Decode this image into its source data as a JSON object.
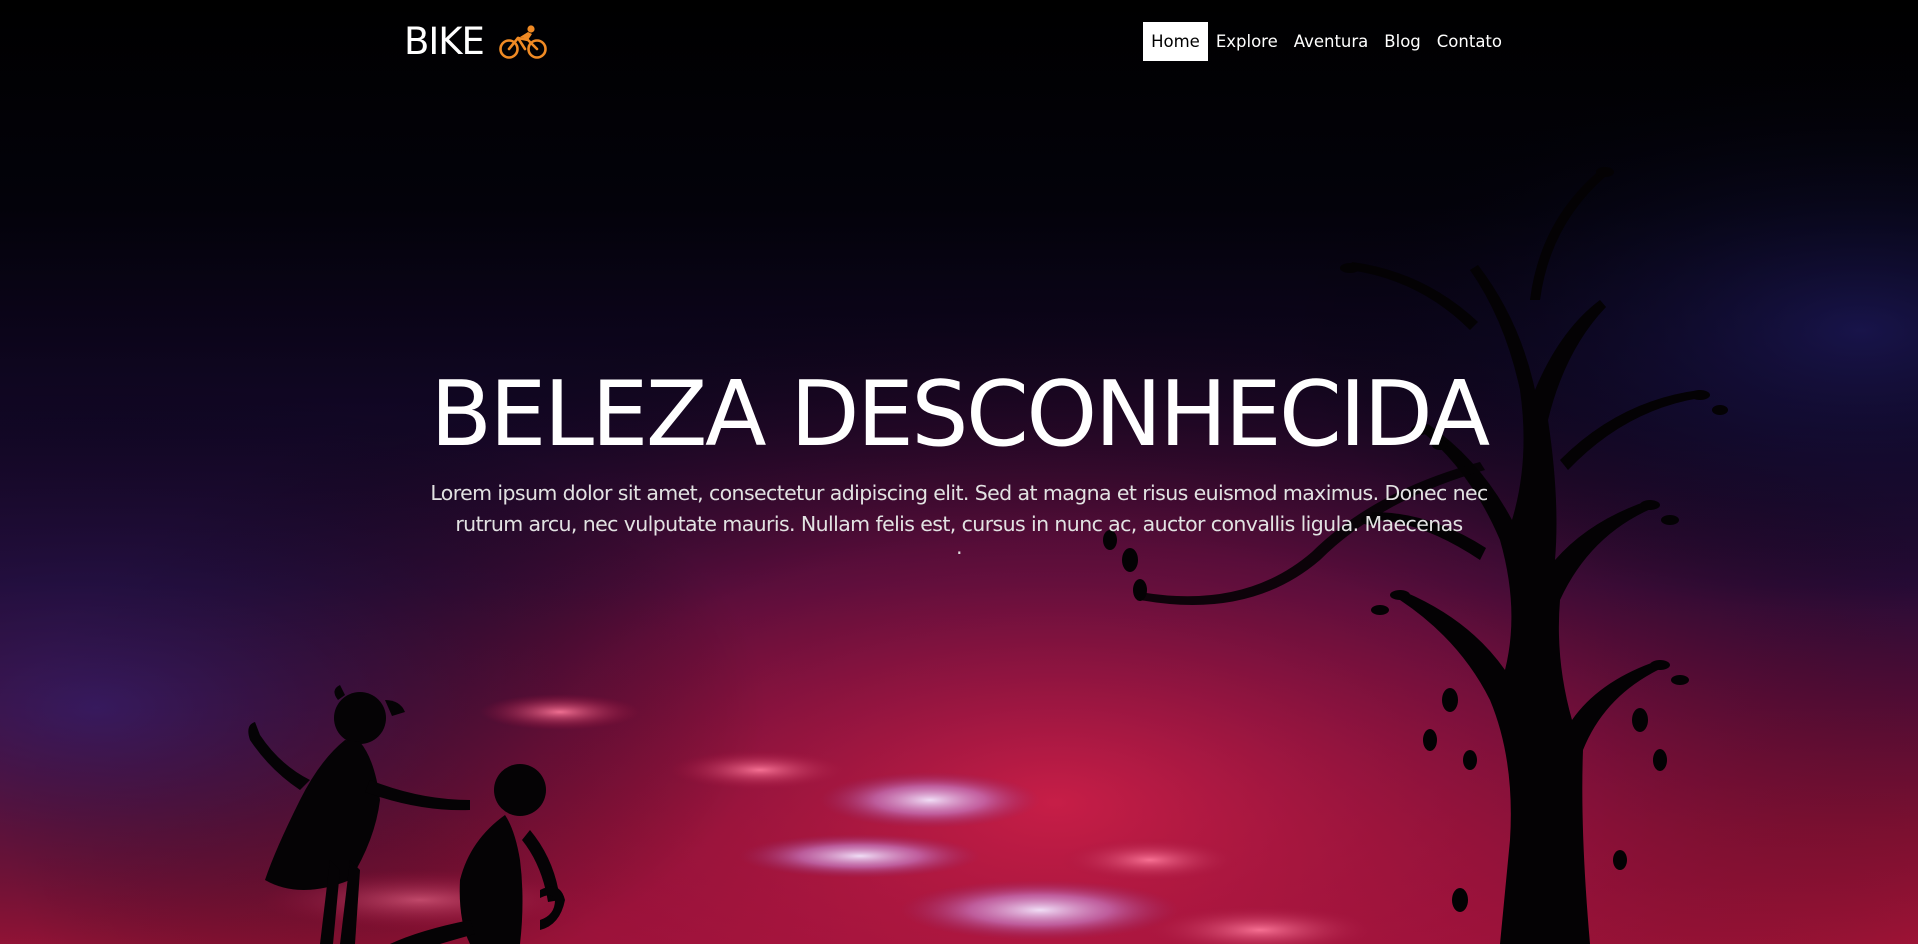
{
  "brand": {
    "name": "BIKE",
    "icon": "cyclist-icon",
    "icon_color": "#f08a24"
  },
  "nav": {
    "items": [
      {
        "label": "Home",
        "active": true
      },
      {
        "label": "Explore",
        "active": false
      },
      {
        "label": "Aventura",
        "active": false
      },
      {
        "label": "Blog",
        "active": false
      },
      {
        "label": "Contato",
        "active": false
      }
    ]
  },
  "hero": {
    "title": "BELEZA DESCONHECIDA",
    "text": "Lorem ipsum dolor sit amet, consectetur adipiscing elit. Sed at magna et risus euismod maximus. Donec nec rutrum arcu, nec vulputate mauris. Nullam felis est, cursus in nunc ac, auctor convallis ligula. Maecenas",
    "trailing": "."
  },
  "colors": {
    "sky_top": "#000000",
    "sky_purple": "#1d0a3a",
    "sky_red": "#c0183a",
    "cloud_pink": "#ff6f8a",
    "nav_active_bg": "#ffffff",
    "nav_active_text": "#000000"
  }
}
